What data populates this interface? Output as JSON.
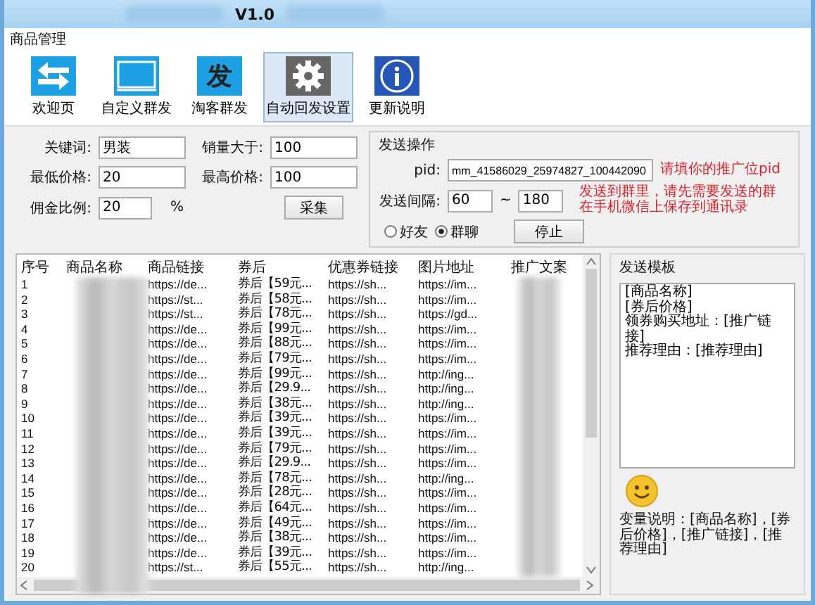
{
  "window": {
    "title": "V1.0"
  },
  "menu": [
    "商品管理"
  ],
  "toolbar": [
    {
      "label": "欢迎页",
      "kind": "arrows",
      "selected": false
    },
    {
      "label": "自定义群发",
      "kind": "monitor",
      "selected": false
    },
    {
      "label": "淘客群发",
      "kind": "glyph",
      "glyph": "发",
      "selected": false
    },
    {
      "label": "自动回发设置",
      "kind": "gear",
      "selected": true
    },
    {
      "label": "更新说明",
      "kind": "info",
      "selected": false
    }
  ],
  "search_form": {
    "fields": [
      {
        "label": "关键词:",
        "value": "男装"
      },
      {
        "label": "销量大于:",
        "value": "100"
      },
      {
        "label": "最低价格:",
        "value": "20"
      },
      {
        "label": "最高价格:",
        "value": "100"
      },
      {
        "label": "佣金比例:",
        "value": "20",
        "unit": "%"
      }
    ],
    "button": "采集"
  },
  "send_panel": {
    "title": "发送操作",
    "pid_label": "pid:",
    "pid": "mm_41586029_25974827_100442090",
    "pid_hint": "请填你的推广位pid",
    "interval_label": "发送间隔:",
    "interval_from": "60",
    "interval_sep": "~",
    "interval_to": "180",
    "hint": "发送到群里，请先需要发送的群在手机微信上保存到通讯录",
    "targets": [
      {
        "label": "好友",
        "selected": false
      },
      {
        "label": "群聊",
        "selected": true
      }
    ],
    "button": "停止"
  },
  "table": {
    "columns": [
      "序号",
      "商品名称",
      "商品链接",
      "券后",
      "优惠券链接",
      "图片地址",
      "推广文案"
    ],
    "rows": [
      {
        "index": "1",
        "link": "https://de...",
        "price": "券后【59元...",
        "coupon_link": "https://sh...",
        "image": "https://im..."
      },
      {
        "index": "2",
        "link": "https://st...",
        "price": "券后【58元...",
        "coupon_link": "https://sh...",
        "image": "https://im..."
      },
      {
        "index": "3",
        "link": "https://st...",
        "price": "券后【78元...",
        "coupon_link": "https://sh...",
        "image": "https://gd..."
      },
      {
        "index": "4",
        "link": "https://de...",
        "price": "券后【99元...",
        "coupon_link": "https://sh...",
        "image": "https://im..."
      },
      {
        "index": "5",
        "link": "https://de...",
        "price": "券后【88元...",
        "coupon_link": "https://sh...",
        "image": "https://im..."
      },
      {
        "index": "6",
        "link": "https://de...",
        "price": "券后【79元...",
        "coupon_link": "https://sh...",
        "image": "https://im..."
      },
      {
        "index": "7",
        "link": "https://de...",
        "price": "券后【99元...",
        "coupon_link": "https://sh...",
        "image": "http://ing..."
      },
      {
        "index": "8",
        "link": "https://de...",
        "price": "券后【29.9...",
        "coupon_link": "https://sh...",
        "image": "http://ing..."
      },
      {
        "index": "9",
        "link": "https://de...",
        "price": "券后【38元...",
        "coupon_link": "https://sh...",
        "image": "http://ing..."
      },
      {
        "index": "10",
        "link": "https://de...",
        "price": "券后【39元...",
        "coupon_link": "https://sh...",
        "image": "https://im..."
      },
      {
        "index": "11",
        "link": "https://de...",
        "price": "券后【39元...",
        "coupon_link": "https://sh...",
        "image": "https://im..."
      },
      {
        "index": "12",
        "link": "https://de...",
        "price": "券后【79元...",
        "coupon_link": "https://sh...",
        "image": "https://im..."
      },
      {
        "index": "13",
        "link": "https://de...",
        "price": "券后【29.9...",
        "coupon_link": "https://sh...",
        "image": "https://im..."
      },
      {
        "index": "14",
        "link": "https://de...",
        "price": "券后【78元...",
        "coupon_link": "https://sh...",
        "image": "http://ing..."
      },
      {
        "index": "15",
        "link": "https://de...",
        "price": "券后【28元...",
        "coupon_link": "https://sh...",
        "image": "https://im..."
      },
      {
        "index": "16",
        "link": "https://de...",
        "price": "券后【64元...",
        "coupon_link": "https://sh...",
        "image": "https://im..."
      },
      {
        "index": "17",
        "link": "https://de...",
        "price": "券后【49元...",
        "coupon_link": "https://sh...",
        "image": "https://im..."
      },
      {
        "index": "18",
        "link": "https://de...",
        "price": "券后【38元...",
        "coupon_link": "https://sh...",
        "image": "https://im..."
      },
      {
        "index": "19",
        "link": "https://de...",
        "price": "券后【39元...",
        "coupon_link": "https://sh...",
        "image": "https://im..."
      },
      {
        "index": "20",
        "link": "https://st...",
        "price": "券后【55元...",
        "coupon_link": "https://sh...",
        "image": "http://ing..."
      }
    ]
  },
  "template_panel": {
    "title": "发送模板",
    "template": "[商品名称]\n[券后价格]\n领券购买地址：[推广链接]\n推荐理由：[推荐理由]",
    "note": "变量说明：[商品名称]，[券后价格]，[推广链接]，[推荐理由]"
  }
}
